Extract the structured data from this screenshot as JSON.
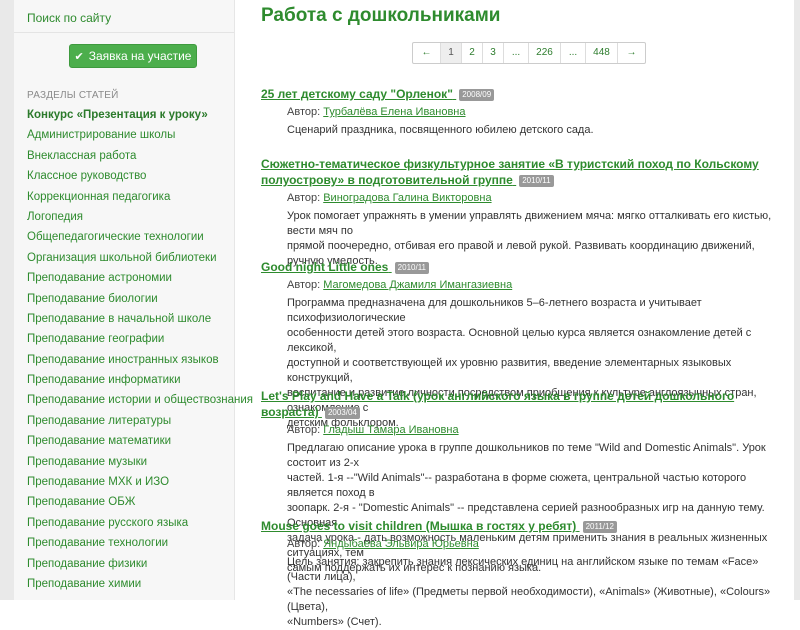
{
  "sidebar": {
    "search_link": "Поиск по сайту",
    "apply_button": "Заявка на участие",
    "section_title": "РАЗДЕЛЫ СТАТЕЙ",
    "categories": [
      "Конкурс «Презентация к уроку»",
      "Администрирование школы",
      "Внеклассная работа",
      "Классное руководство",
      "Коррекционная педагогика",
      "Логопедия",
      "Общепедагогические технологии",
      "Организация школьной библиотеки",
      "Преподавание астрономии",
      "Преподавание биологии",
      "Преподавание в начальной школе",
      "Преподавание географии",
      "Преподавание иностранных языков",
      "Преподавание информатики",
      "Преподавание истории и обществознания",
      "Преподавание литературы",
      "Преподавание математики",
      "Преподавание музыки",
      "Преподавание МХК и ИЗО",
      "Преподавание ОБЖ",
      "Преподавание русского языка",
      "Преподавание технологии",
      "Преподавание физики",
      "Преподавание химии"
    ]
  },
  "main": {
    "title": "Работа с дошкольниками",
    "pagination": [
      "←",
      "1",
      "2",
      "3",
      "...",
      "226",
      "...",
      "448",
      "→"
    ],
    "author_label": "Автор:",
    "articles": [
      {
        "title": "25 лет детскому саду \"Орленок\"",
        "date": "2008/09",
        "author": "Турбалёва Елена Ивановна",
        "desc": [
          "Сценарий праздника, посвященного юбилею детского сада."
        ]
      },
      {
        "title": "Сюжетно-тематическое физкультурное занятие «В туристский поход по Кольскому полуострову» в подготовительной группе",
        "date": "2010/11",
        "author": "Виноградова Галина Викторовна",
        "desc": [
          "Урок помогает упражнять в умении управлять движением мяча: мягко отталкивать его кистью, вести мяч по",
          "прямой поочередно, отбивая его правой и левой рукой. Развивать координацию движений, ручную умелость."
        ]
      },
      {
        "title": "Good night Little ones",
        "date": "2010/11",
        "author": "Магомедова Джамиля Имангазиевна",
        "desc": [
          "Программа предназначена для дошкольников 5–6-летнего возраста и учитывает психофизиологические",
          "особенности детей этого возраста. Основной целью курса является ознакомление детей с лексикой,",
          "доступной и соответствующей их уровню развития, введение элементарных языковых конструкций,",
          "воспитание и развитие личности посредством приобщения к культуре англоязычных стран, ознакомление с",
          "детским фольклором."
        ]
      },
      {
        "title": "Let's Play and Have a Talk (урок английского языка в группе детей дошкольного возраста)",
        "date": "2003/04",
        "author": "Гладыш Тамара Ивановна",
        "desc": [
          "Предлагаю описание урока в группе дошкольников по теме \"Wild and Domestic Animals\". Урок состоит из 2-х",
          "частей. 1-я --\"Wild Animals\"-- разработана в форме сюжета, центральной частью которого является поход в",
          "зоопарк. 2-я - \"Domestic Animals\" -- представлена серией разнообразных игр на данную тему. Основная",
          "задача урока - дать возможность маленьким детям применить знания в реальных жизненных ситуациях, тем",
          "самым поддержать их интерес к познанию языка."
        ]
      },
      {
        "title": "Mouse goes to visit children (Мышка в гостях у ребят)",
        "date": "2011/12",
        "author": "Яндыбаева Эльвира Юрьевна",
        "desc": [
          "Цель занятия: закрепить знания лексических единиц на английском языке по темам «Face» (Части лица),",
          "«The necessaries of life» (Предметы первой необходимости), «Animals» (Животные), «Colours» (Цвета),",
          "«Numbers» (Счет)."
        ]
      }
    ]
  }
}
